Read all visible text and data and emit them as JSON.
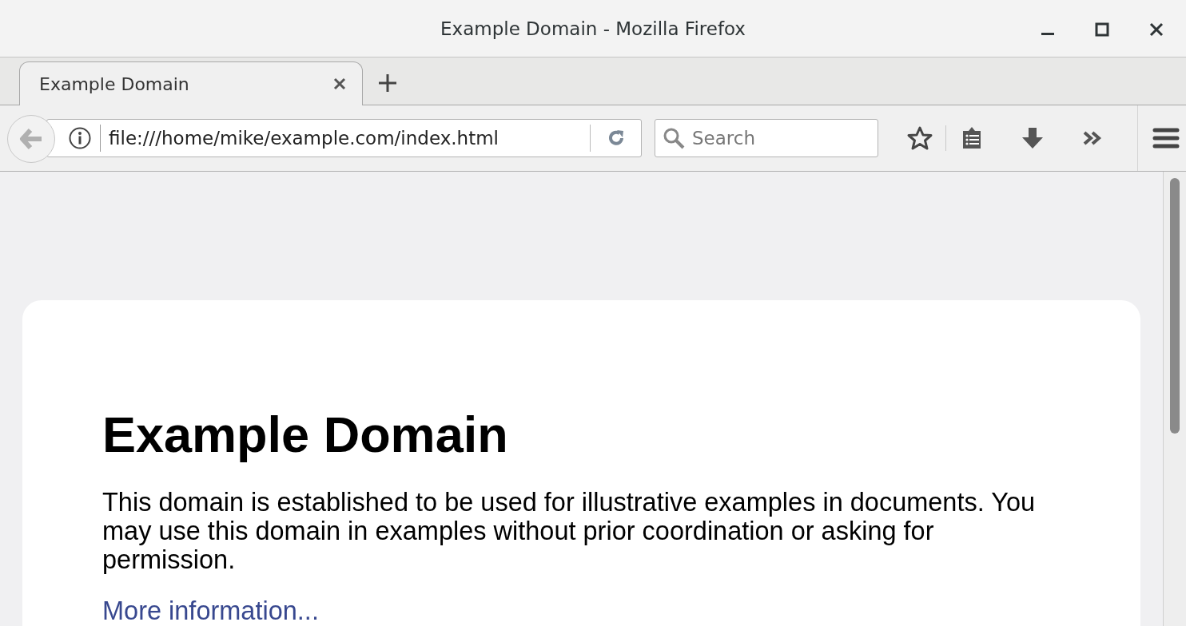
{
  "window": {
    "title": "Example Domain - Mozilla Firefox"
  },
  "tabs": [
    {
      "label": "Example Domain",
      "selected": true
    }
  ],
  "address_bar": {
    "value": "file:///home/mike/example.com/index.html"
  },
  "search": {
    "placeholder": "Search"
  },
  "page": {
    "heading": "Example Domain",
    "paragraph": "This domain is established to be used for illustrative examples in documents. You may use this domain in examples without prior coordination or asking for permission.",
    "link": "More information..."
  }
}
